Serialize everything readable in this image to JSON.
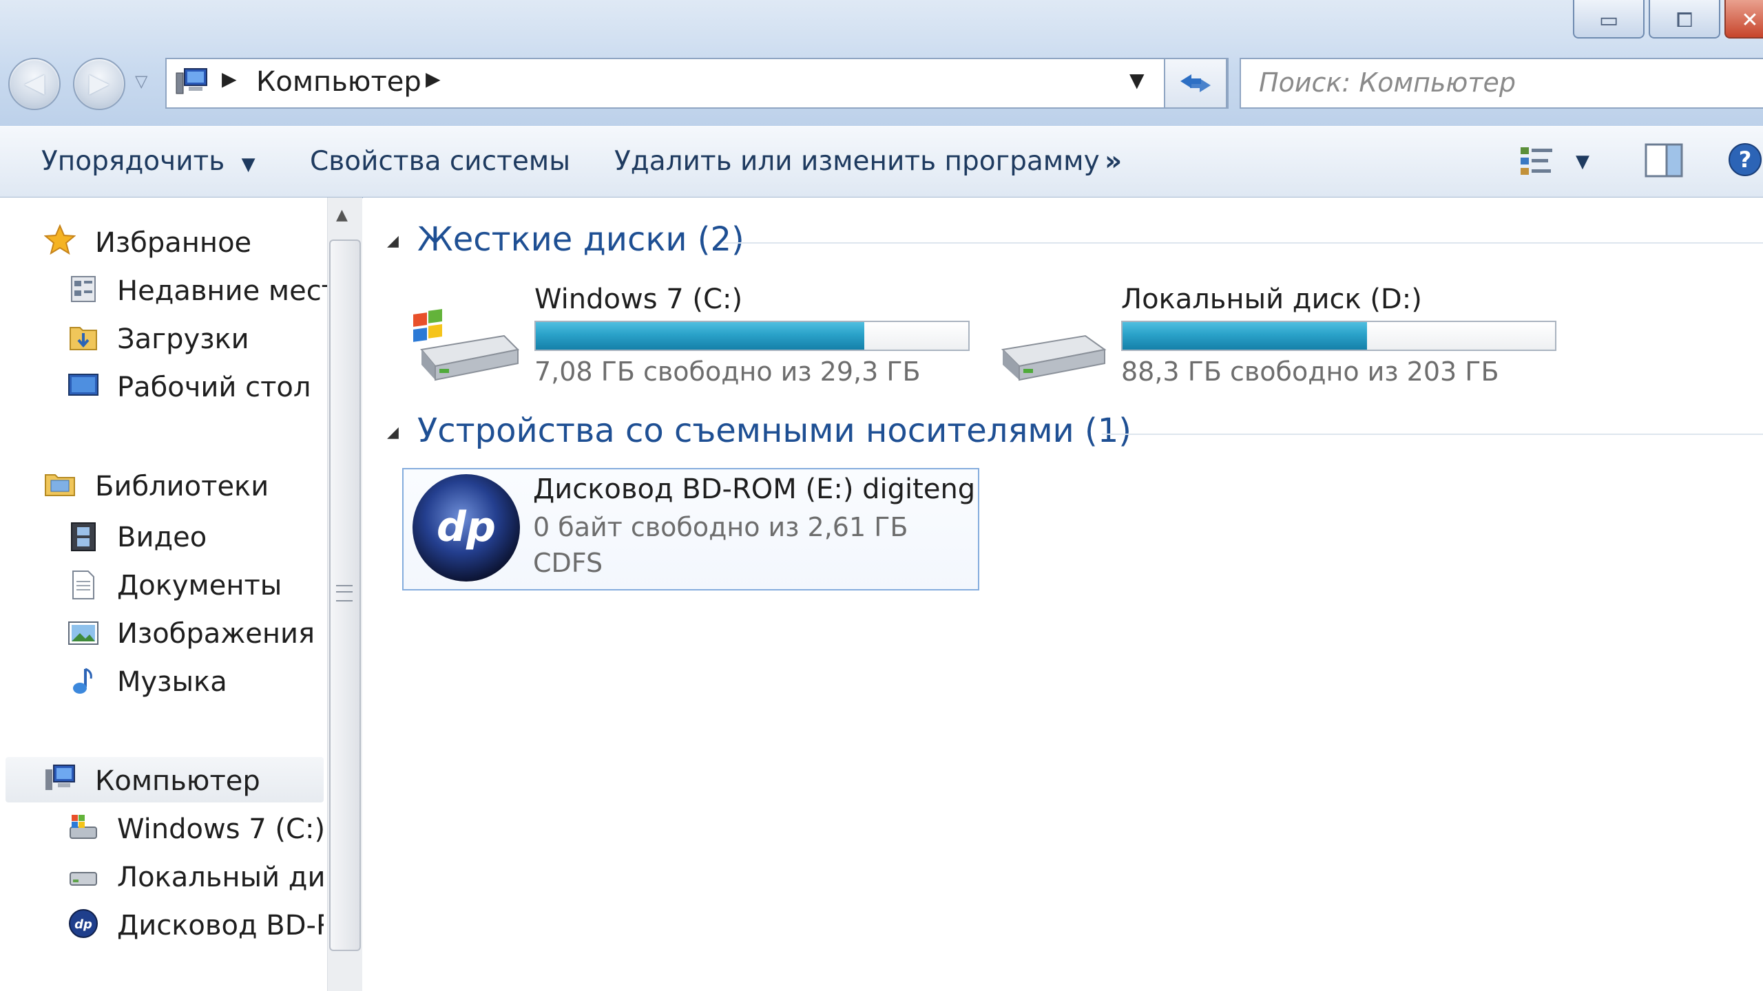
{
  "window": {
    "buttons": {
      "minimize": "▭",
      "maximize": "⧠",
      "close": "✕"
    }
  },
  "address_bar": {
    "path": "Компьютер",
    "search_placeholder": "Поиск: Компьютер"
  },
  "toolbar": {
    "organize": "Упорядочить",
    "system_properties": "Свойства системы",
    "uninstall": "Удалить или изменить программу",
    "more": "»"
  },
  "nav": {
    "favorites": {
      "label": "Избранное",
      "items": [
        "Недавние места",
        "Загрузки",
        "Рабочий стол"
      ]
    },
    "libraries": {
      "label": "Библиотеки",
      "items": [
        "Видео",
        "Документы",
        "Изображения",
        "Музыка"
      ]
    },
    "computer": {
      "label": "Компьютер",
      "items": [
        "Windows 7 (C:)",
        "Локальный диск",
        "Дисковод BD-RC"
      ]
    }
  },
  "content": {
    "hard_drives": {
      "title": "Жесткие диски (2)",
      "drives": [
        {
          "name": "Windows 7 (C:)",
          "info": "7,08 ГБ свободно из 29,3 ГБ",
          "used_fraction": 0.76
        },
        {
          "name": "Локальный диск (D:)",
          "info": "88,3 ГБ свободно из 203 ГБ",
          "used_fraction": 0.565
        }
      ]
    },
    "removable": {
      "title": "Устройства со съемными носителями (1)",
      "device": {
        "name": "Дисковод BD-ROM (E:) digiteng",
        "info": "0 байт свободно из 2,61 ГБ",
        "fs": "CDFS",
        "logo_text": "dp"
      }
    }
  },
  "colors": {
    "accent": "#1e4f93",
    "bar_fill": "#2aa2c9",
    "chrome": "#c9daef"
  }
}
